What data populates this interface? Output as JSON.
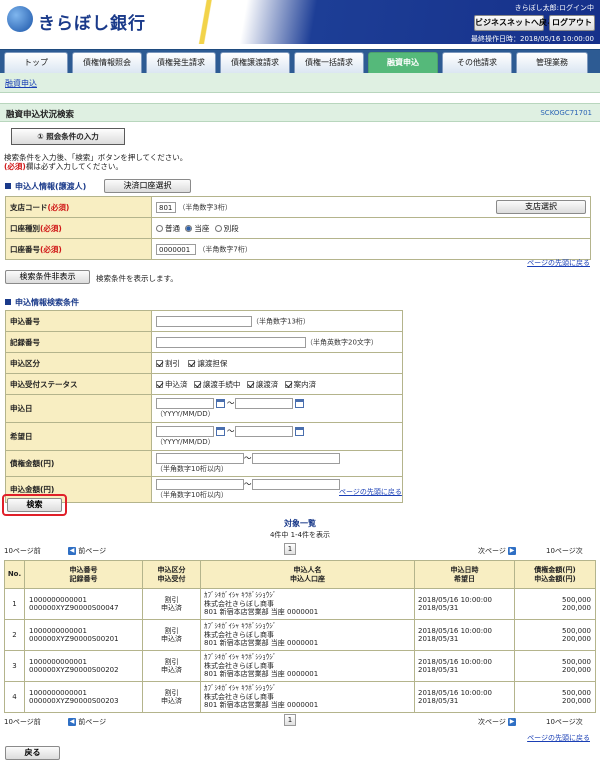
{
  "header": {
    "logo_text": "きらぼし銀行",
    "user_greeting": "きらぼし太郎:ログイン中",
    "bizweb_back_button": "ビジネスネットへ戻る",
    "logout_button": "ログアウト",
    "last_operation": "最終操作日時：2018/05/16 10:00:00"
  },
  "tabs": [
    {
      "label": "トップ"
    },
    {
      "label": "債権情報照会"
    },
    {
      "label": "債権発生請求"
    },
    {
      "label": "債権譲渡請求"
    },
    {
      "label": "債権一括請求"
    },
    {
      "label": "融資申込"
    },
    {
      "label": "その他請求"
    },
    {
      "label": "管理業務"
    }
  ],
  "subnav": {
    "link": "融資申込"
  },
  "page": {
    "title": "融資申込状況検索",
    "screen_id": "SCKOGC71701",
    "step_label": "① 照会条件の入力",
    "instructions_1": "検索条件を入力後、「検索」ボタンを押してください。",
    "req_mark": "(必須)",
    "instructions_2": "欄は必ず入力してください。"
  },
  "applicant": {
    "title": "申込人情報(譲渡人)",
    "settle_acct_button": "決済口座選択",
    "branch_label": "支店コード",
    "req": "(必須)",
    "branch_value": "801",
    "branch_hint": "（半角数字3桁）",
    "branch_select_button": "支店選択",
    "acct_type_label": "口座種別",
    "acct_types": [
      "普通",
      "当座",
      "別段"
    ],
    "acct_no_label": "口座番号",
    "acct_no_value": "0000001",
    "acct_no_hint": "（半角数字7桁）"
  },
  "page_top_link": "ページの先頭に戻る",
  "toggle": {
    "button": "検索条件非表示",
    "note": "検索条件を表示します。"
  },
  "search": {
    "title": "申込情報検索条件",
    "rows": {
      "app_no": "申込番号",
      "app_no_hint": "（半角数字13桁）",
      "rec_no": "記録番号",
      "rec_no_hint": "（半角英数字20文字）",
      "app_type": "申込区分",
      "app_type_opts": [
        "割引",
        "譲渡担保"
      ],
      "status": "申込受付ステータス",
      "status_opts": [
        "申込済",
        "譲渡手続中",
        "譲渡済",
        "案内済"
      ],
      "app_date": "申込日",
      "date_hint": "（YYYY/MM/DD）",
      "wish_date": "希望日",
      "claim_amt": "債権金額(円)",
      "amt_hint": "（半角数字10桁以内）",
      "app_amt": "申込金額(円)",
      "tilde": "～"
    }
  },
  "search_button": "検索",
  "results": {
    "title": "対象一覧",
    "count": "4件中 1-4件を表示",
    "prev10": "10ページ前",
    "prev": "前ページ",
    "page": "1",
    "next": "次ページ",
    "next10": "10ページ次",
    "headers": {
      "no": "No.",
      "app_no": "申込番号",
      "rec_no": "記録番号",
      "type": "申込区分",
      "status": "申込受付",
      "name": "申込人名",
      "acct": "申込人口座",
      "date": "申込日時",
      "wish": "希望日",
      "claim": "債権金額(円)",
      "amount": "申込金額(円)"
    },
    "rows": [
      {
        "no": "1",
        "app_no": "1000000000001",
        "rec_no": "000000XYZ90000S00047",
        "type": "割引",
        "status": "申込済",
        "kana": "ｶﾌﾞｼｷｶﾞｲｼｬ ｷﾗﾎﾞｼｼｮｳｼﾞ",
        "name": "株式会社きらぼし商事",
        "acct": "801 新宿本店営業部 当座 0000001",
        "date": "2018/05/16 10:00:00",
        "wish": "2018/05/31",
        "claim": "500,000",
        "amount": "200,000"
      },
      {
        "no": "2",
        "app_no": "1000000000001",
        "rec_no": "000000XYZ90000S00201",
        "type": "割引",
        "status": "申込済",
        "kana": "ｶﾌﾞｼｷｶﾞｲｼｬ ｷﾗﾎﾞｼｼｮｳｼﾞ",
        "name": "株式会社きらぼし商事",
        "acct": "801 新宿本店営業部 当座 0000001",
        "date": "2018/05/16 10:00:00",
        "wish": "2018/05/31",
        "claim": "500,000",
        "amount": "200,000"
      },
      {
        "no": "3",
        "app_no": "1000000000001",
        "rec_no": "000000XYZ90000S00202",
        "type": "割引",
        "status": "申込済",
        "kana": "ｶﾌﾞｼｷｶﾞｲｼｬ ｷﾗﾎﾞｼｼｮｳｼﾞ",
        "name": "株式会社きらぼし商事",
        "acct": "801 新宿本店営業部 当座 0000001",
        "date": "2018/05/16 10:00:00",
        "wish": "2018/05/31",
        "claim": "500,000",
        "amount": "200,000"
      },
      {
        "no": "4",
        "app_no": "1000000000001",
        "rec_no": "000000XYZ90000S00203",
        "type": "割引",
        "status": "申込済",
        "kana": "ｶﾌﾞｼｷｶﾞｲｼｬ ｷﾗﾎﾞｼｼｮｳｼﾞ",
        "name": "株式会社きらぼし商事",
        "acct": "801 新宿本店営業部 当座 0000001",
        "date": "2018/05/16 10:00:00",
        "wish": "2018/05/31",
        "claim": "500,000",
        "amount": "200,000"
      }
    ]
  },
  "back_button": "戻る",
  "colors": {
    "accent_green": "#55b97a",
    "nav_blue": "#2d5b93",
    "label_bg": "#f8eec2",
    "highlight_red": "#e0202a"
  }
}
